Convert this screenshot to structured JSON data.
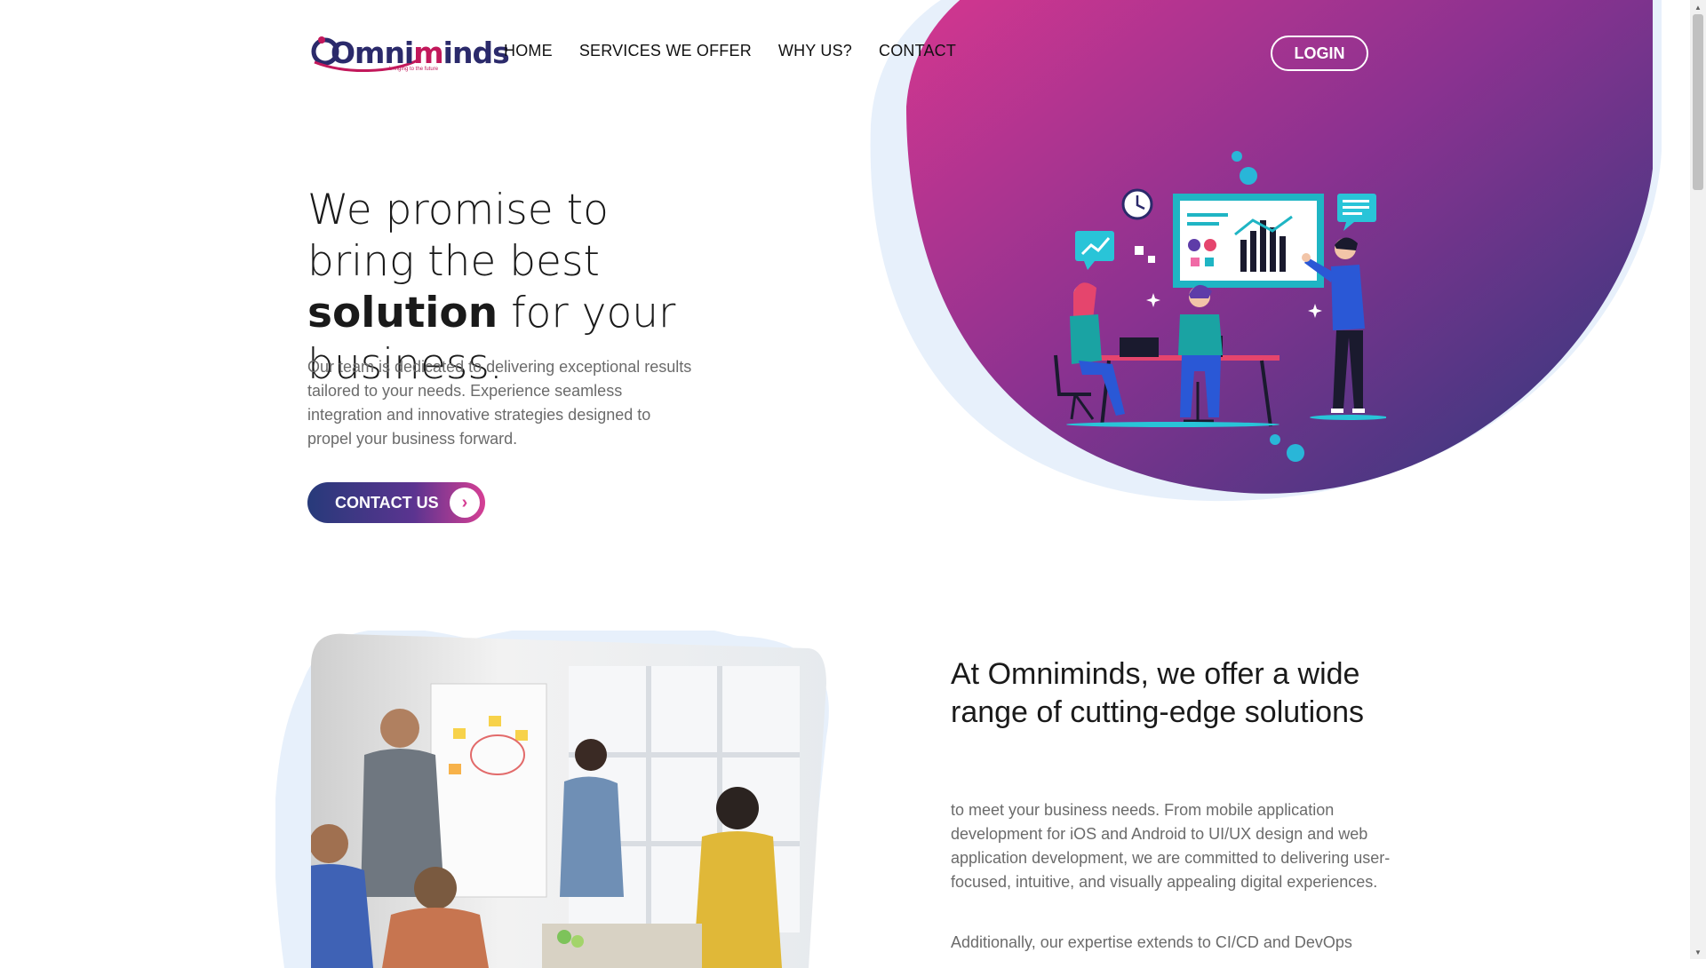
{
  "colors": {
    "brand_pink": "#d63f94",
    "brand_navy": "#273a7a",
    "brand_purple": "#5b3490",
    "light_blue_blob": "#e7f0fb",
    "body_text": "#6b6b6b"
  },
  "header": {
    "logo_text_left": "Omni",
    "logo_text_mid": "m",
    "logo_text_right": "inds",
    "logo_tagline": "bringing to the future",
    "nav": [
      {
        "label": "HOME"
      },
      {
        "label": "SERVICES WE OFFER"
      },
      {
        "label": "WHY US?"
      },
      {
        "label": "CONTACT"
      }
    ],
    "login_label": "LOGIN"
  },
  "hero": {
    "title_part1": "We promise to bring the best ",
    "title_bold": "solution",
    "title_part2": " for your business.",
    "description": "Our team is dedicated to delivering exceptional results tailored to your needs. Experience seamless integration and innovative strategies designed to propel your business forward.",
    "cta_label": "CONTACT US",
    "cta_icon": "chevron-right-icon"
  },
  "services": {
    "title": "At Omniminds, we offer a wide range of cutting-edge solutions",
    "paragraph1": "to meet your business needs. From mobile application development for iOS and Android to UI/UX design and web application development, we are committed to delivering user-focused, intuitive, and visually appealing digital experiences.",
    "paragraph2": "Additionally, our expertise extends to CI/CD and DevOps"
  }
}
